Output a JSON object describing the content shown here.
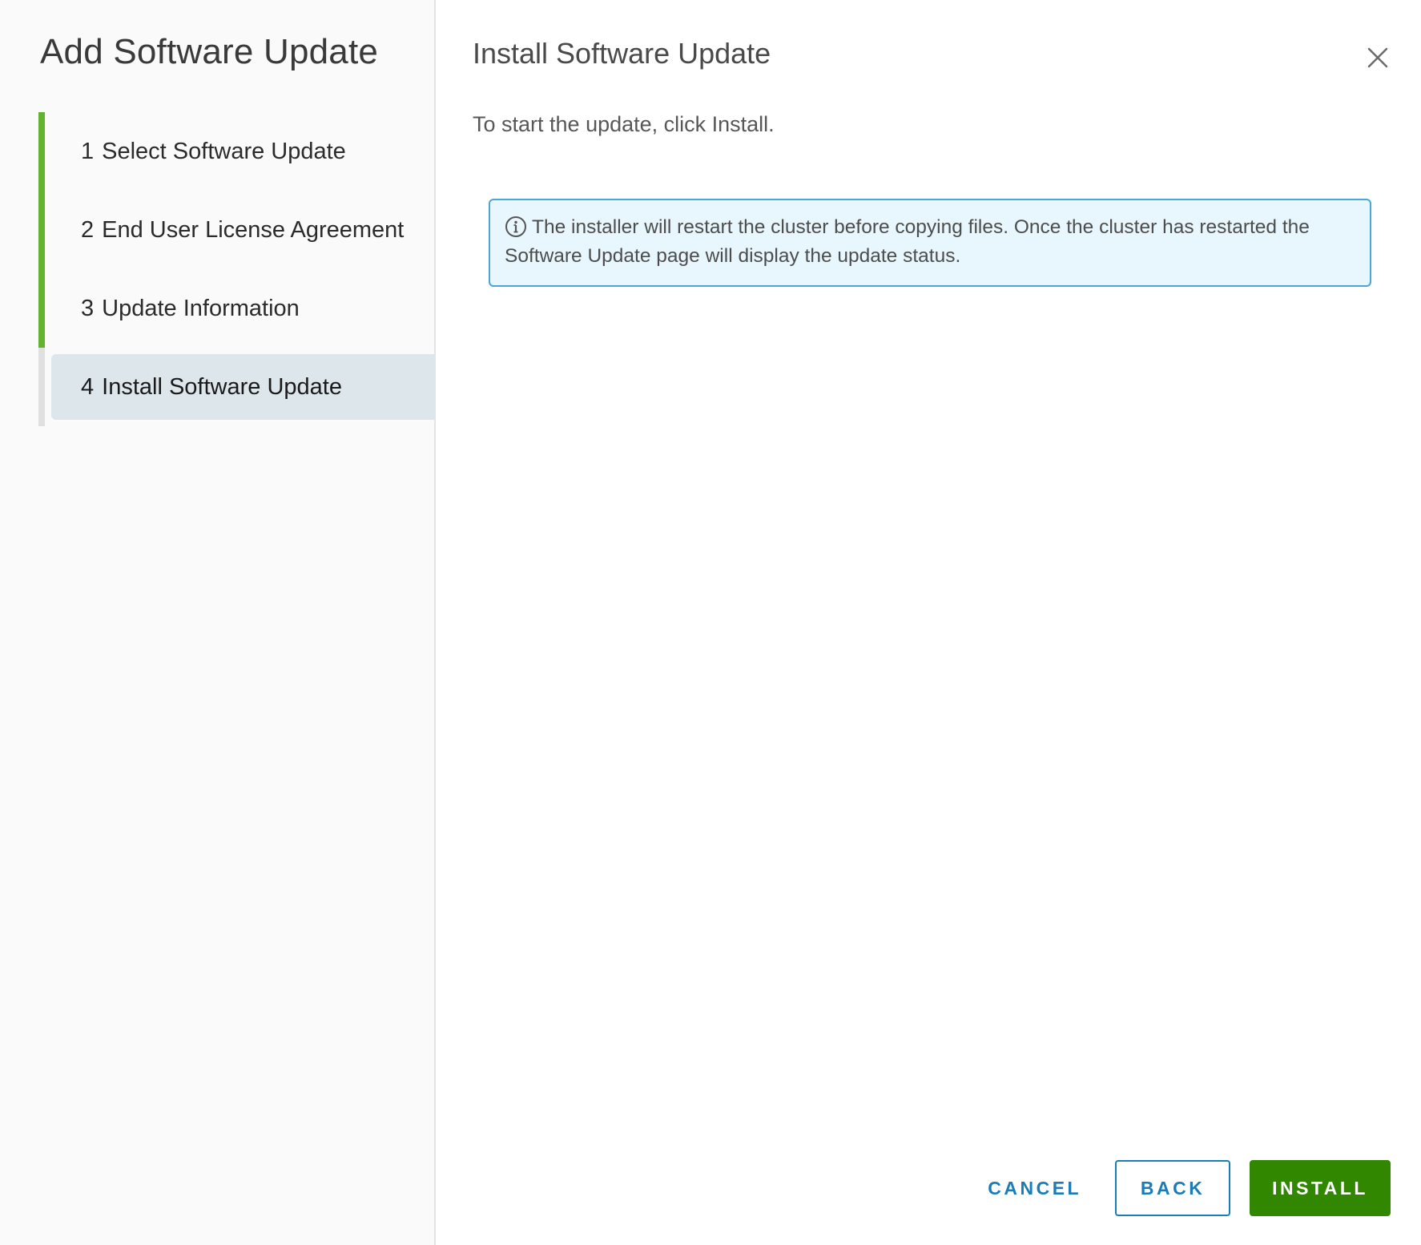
{
  "wizard": {
    "title": "Add Software Update",
    "steps": [
      {
        "number": "1",
        "label": "Select Software Update",
        "state": "completed"
      },
      {
        "number": "2",
        "label": "End User License Agreement",
        "state": "completed"
      },
      {
        "number": "3",
        "label": "Update Information",
        "state": "completed"
      },
      {
        "number": "4",
        "label": "Install Software Update",
        "state": "current"
      }
    ]
  },
  "page": {
    "title": "Install Software Update",
    "instruction": "To start the update, click Install.",
    "alert": {
      "icon": "info-icon",
      "text": "The installer will restart the cluster before copying files. Once the cluster has restarted the Software Update page will display the update status."
    },
    "close_icon": "close-icon"
  },
  "footer": {
    "cancel_label": "CANCEL",
    "back_label": "BACK",
    "install_label": "INSTALL"
  },
  "colors": {
    "progress_completed": "#62b32f",
    "progress_pending": "#e0e0e0",
    "current_step_bg": "#dde6eb",
    "alert_bg": "#e8f6fd",
    "alert_border": "#49a6d6",
    "link_blue": "#1a7cb8",
    "primary_green": "#318700"
  }
}
